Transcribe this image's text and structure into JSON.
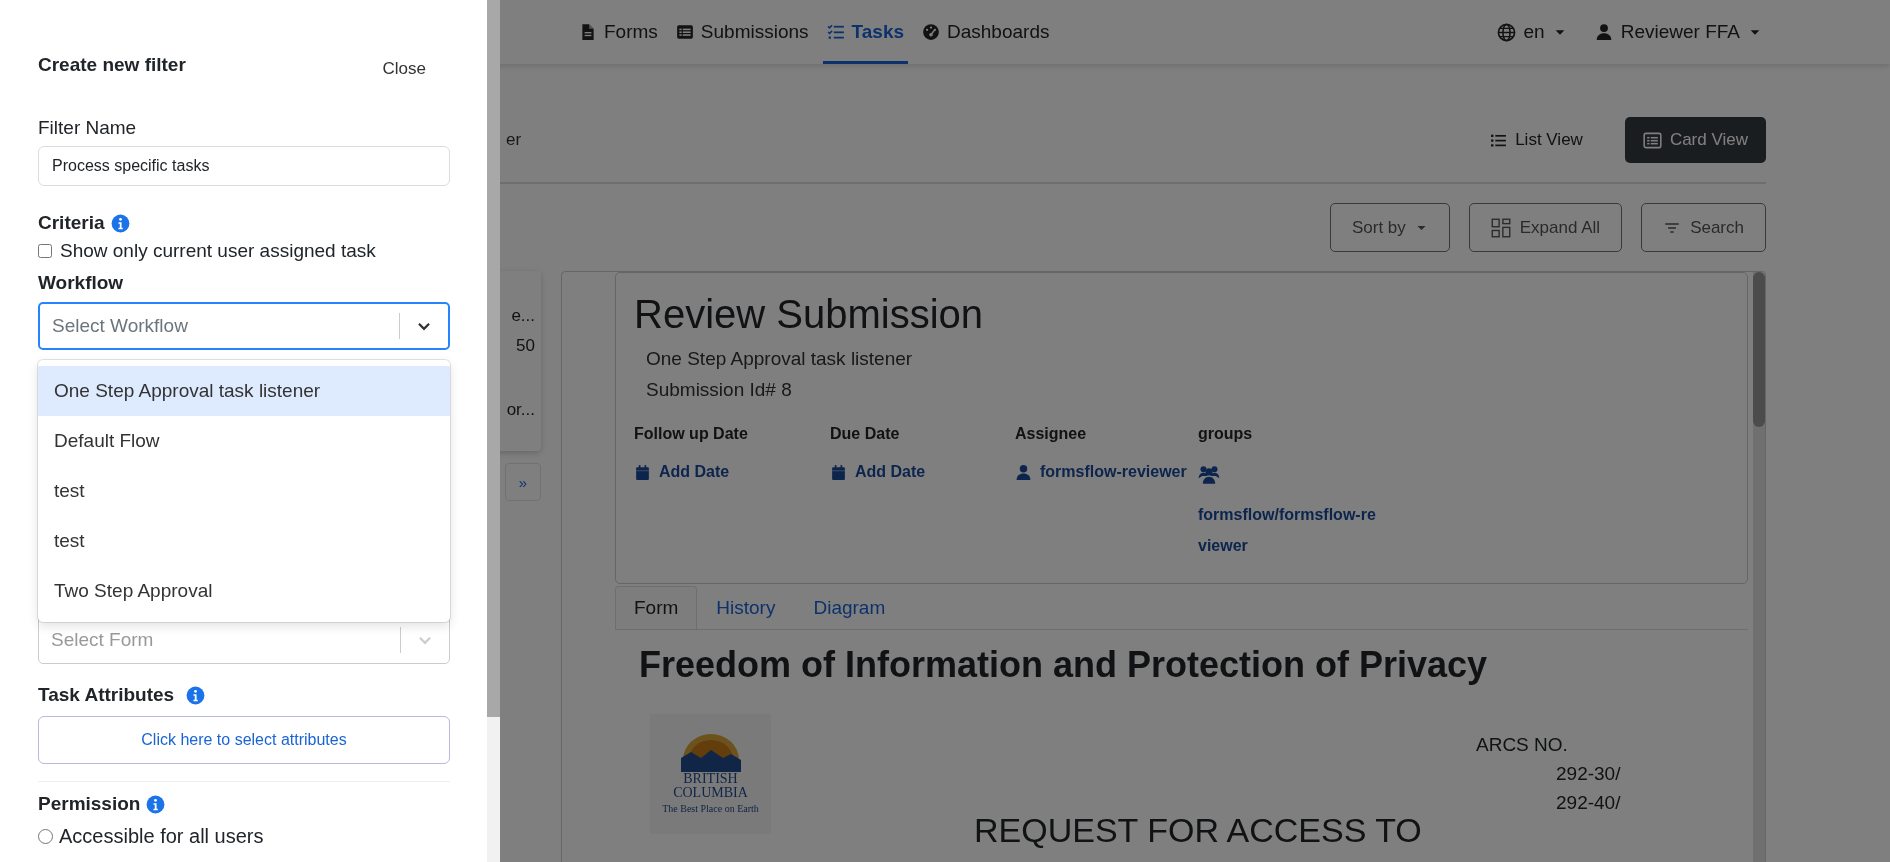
{
  "filter_panel": {
    "title": "Create new filter",
    "close": "Close",
    "filter_name": {
      "label": "Filter Name",
      "value": "Process specific tasks"
    },
    "criteria": {
      "label": "Criteria",
      "option": {
        "label": "Show only current user assigned task",
        "checked": false
      }
    },
    "workflow": {
      "label": "Workflow",
      "placeholder": "Select Workflow",
      "expanded": true,
      "options": [
        {
          "label": "One Step Approval task listener",
          "selected": true
        },
        {
          "label": "Default Flow",
          "selected": false
        },
        {
          "label": "test",
          "selected": false
        },
        {
          "label": "test",
          "selected": false
        },
        {
          "label": "Two Step Approval",
          "selected": false
        }
      ]
    },
    "form_select": {
      "placeholder": "Select Form"
    },
    "task_attributes": {
      "label": "Task Attributes",
      "button": "Click here to select attributes"
    },
    "permission": {
      "label": "Permission",
      "options": [
        {
          "label": "Accessible for all users",
          "selected": false
        }
      ]
    }
  },
  "navbar": {
    "items": [
      {
        "label": "Forms",
        "selected": false
      },
      {
        "label": "Submissions",
        "selected": false
      },
      {
        "label": "Tasks",
        "selected": true
      },
      {
        "label": "Dashboards",
        "selected": false
      }
    ],
    "language": "en",
    "user": "Reviewer FFA"
  },
  "toolbar": {
    "cut_text": "er",
    "views": [
      {
        "label": "List View",
        "selected": false
      },
      {
        "label": "Card View",
        "selected": true
      }
    ],
    "actions": [
      {
        "label": "Sort by",
        "kind": "dropdown"
      },
      {
        "label": "Expand All",
        "kind": "grid"
      },
      {
        "label": "Search",
        "kind": "filter"
      }
    ]
  },
  "task_list": {
    "card_lines": [
      "e...",
      "50",
      "or..."
    ],
    "pagination": "»"
  },
  "task_detail": {
    "title": "Review Submission",
    "process": "One Step Approval task listener",
    "submission_id": "Submission Id# 8",
    "fields": [
      {
        "label": "Follow up Date",
        "value": "Add Date",
        "kind": "date"
      },
      {
        "label": "Due Date",
        "value": "Add Date",
        "kind": "date"
      },
      {
        "label": "Assignee",
        "value": "formsflow-reviewer",
        "kind": "user"
      },
      {
        "label": "groups",
        "value": "formsflow/formsflow-reviewer",
        "kind": "group"
      }
    ],
    "tabs": [
      {
        "label": "Form",
        "selected": true
      },
      {
        "label": "History",
        "selected": false
      },
      {
        "label": "Diagram",
        "selected": false
      }
    ],
    "form": {
      "heading": "Freedom of Information and Protection of Privacy",
      "logo_lines": [
        "BRITISH",
        "COLUMBIA",
        "The Best Place on Earth"
      ],
      "arcs_label": "ARCS NO.",
      "arcs_numbers": [
        "292-30/",
        "292-40/"
      ],
      "request": "REQUEST FOR ACCESS TO"
    }
  }
}
